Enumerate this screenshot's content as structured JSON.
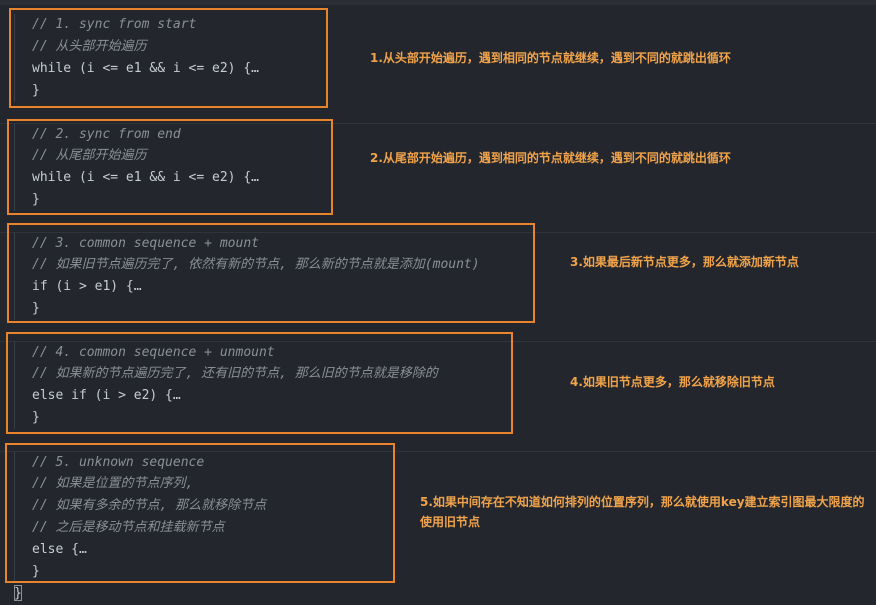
{
  "blocks": [
    {
      "lines": [
        {
          "type": "comment",
          "text": "// 1. sync from start"
        },
        {
          "type": "comment",
          "text": "// 从头部开始遍历"
        },
        {
          "type": "code",
          "text": "while (i <= e1 && i <= e2) {…"
        },
        {
          "type": "code",
          "text": "}"
        }
      ],
      "note": "1.从头部开始遍历，遇到相同的节点就继续，遇到不同的就跳出循环"
    },
    {
      "lines": [
        {
          "type": "comment",
          "text": "// 2. sync from end"
        },
        {
          "type": "comment",
          "text": "// 从尾部开始遍历"
        },
        {
          "type": "code",
          "text": "while (i <= e1 && i <= e2) {…"
        },
        {
          "type": "code",
          "text": "}"
        }
      ],
      "note": "2.从尾部开始遍历，遇到相同的节点就继续，遇到不同的就跳出循环"
    },
    {
      "lines": [
        {
          "type": "comment",
          "text": "// 3. common sequence + mount"
        },
        {
          "type": "comment",
          "text": "// 如果旧节点遍历完了, 依然有新的节点, 那么新的节点就是添加(mount)"
        },
        {
          "type": "code",
          "text": "if (i > e1) {…"
        },
        {
          "type": "code",
          "text": "}"
        }
      ],
      "note": "3.如果最后新节点更多，那么就添加新节点"
    },
    {
      "lines": [
        {
          "type": "comment",
          "text": "// 4. common sequence + unmount"
        },
        {
          "type": "comment",
          "text": "// 如果新的节点遍历完了, 还有旧的节点, 那么旧的节点就是移除的"
        },
        {
          "type": "code",
          "text": "else if (i > e2) {…"
        },
        {
          "type": "code",
          "text": "}"
        }
      ],
      "note": "4.如果旧节点更多，那么就移除旧节点"
    },
    {
      "lines": [
        {
          "type": "comment",
          "text": "// 5. unknown sequence"
        },
        {
          "type": "comment",
          "text": "// 如果是位置的节点序列,"
        },
        {
          "type": "comment",
          "text": "// 如果有多余的节点, 那么就移除节点"
        },
        {
          "type": "comment",
          "text": "// 之后是移动节点和挂载新节点"
        },
        {
          "type": "code",
          "text": "else {…"
        },
        {
          "type": "code",
          "text": "}"
        }
      ],
      "note": "5.如果中间存在不知道如何排列的位置序列，那么就使用key建立索引图最大限度的使用旧节点"
    }
  ],
  "closing_brace": "}"
}
